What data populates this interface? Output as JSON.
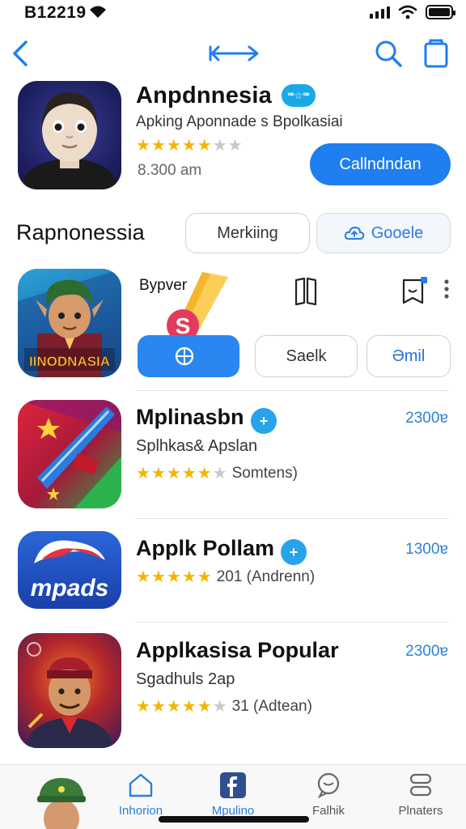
{
  "status_bar": {
    "time": "B12219"
  },
  "featured": {
    "title": "Anpdnnesia",
    "badge": "ꟹ☆ꟹ",
    "subtitle": "Apking Aponnade s Bpolkasiai",
    "rating_stars": 5,
    "meta": "8.300 am",
    "button_label": "Callndndan"
  },
  "section": {
    "title": "Rapnonessia",
    "marking_label": "Merkiing",
    "google_label": "Gooele"
  },
  "row2": {
    "title": "Bypver",
    "icon_caption": "IINODNASIA",
    "saek_label": "Saelk",
    "small_label": "Əmil"
  },
  "list": [
    {
      "title": "Mplinasbn",
      "subtitle": "Splhkas& Apslan",
      "rating_count": "Somtens)",
      "price": "2300ɐ"
    },
    {
      "title": "Applk Pollam",
      "subtitle": "",
      "rating_count": "201 (Andrenn)",
      "price": "1300ɐ"
    },
    {
      "title": "Applkasisa Popular",
      "subtitle": "Sgadhuls 2ap",
      "rating_count": "31 (Adtean)",
      "price": "2300ɐ"
    }
  ],
  "list_icons": {
    "mpads_label": "mpads"
  },
  "tabs": [
    {
      "label": "Inhorion"
    },
    {
      "label": "Mpulino"
    },
    {
      "label": "Falhik"
    },
    {
      "label": "Plnaters"
    }
  ],
  "colors": {
    "accent": "#1f7ef0",
    "star": "#f5b400",
    "price": "#2b82d8"
  }
}
